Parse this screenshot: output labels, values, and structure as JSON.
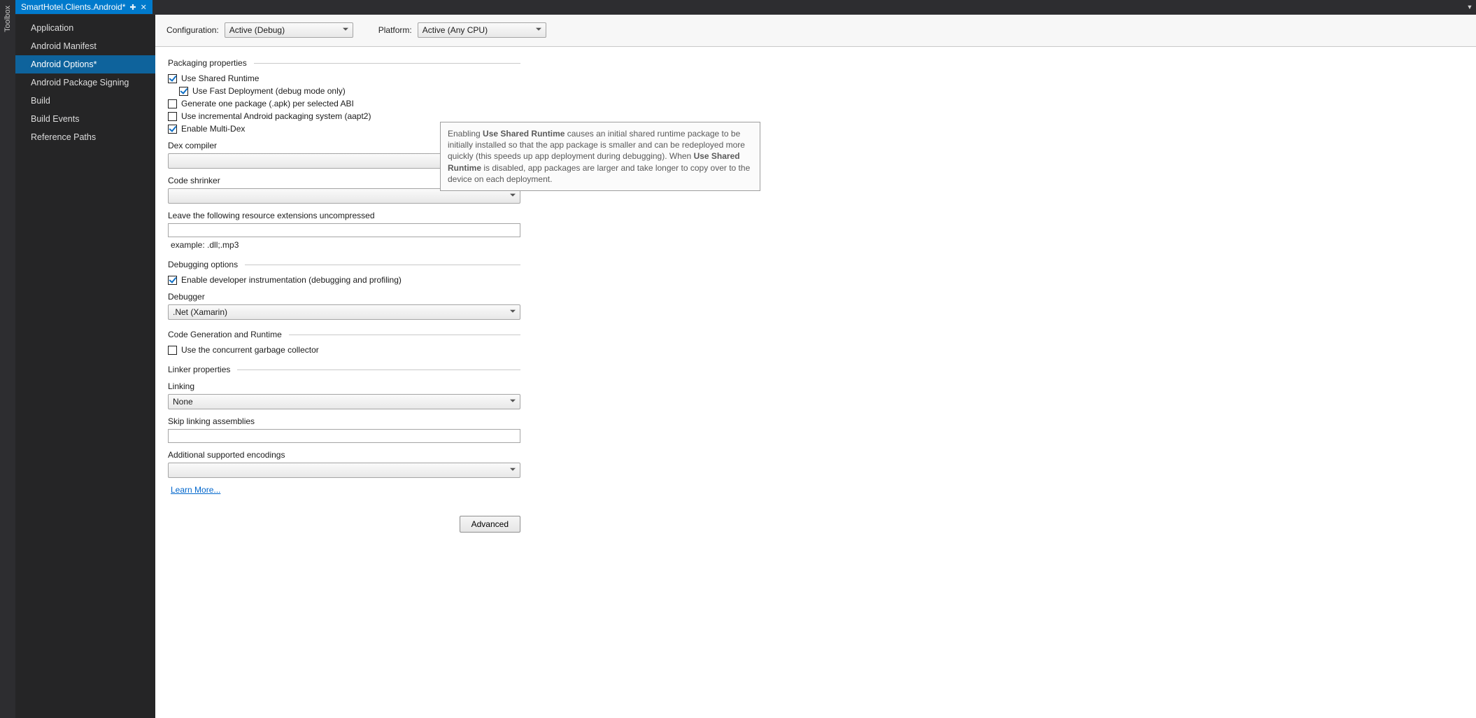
{
  "toolbox": {
    "label": "Toolbox"
  },
  "tab": {
    "title": "SmartHotel.Clients.Android*"
  },
  "sidebar": {
    "items": [
      {
        "label": "Application"
      },
      {
        "label": "Android Manifest"
      },
      {
        "label": "Android Options*"
      },
      {
        "label": "Android Package Signing"
      },
      {
        "label": "Build"
      },
      {
        "label": "Build Events"
      },
      {
        "label": "Reference Paths"
      }
    ],
    "selected_index": 2
  },
  "config": {
    "configuration_label": "Configuration:",
    "configuration_value": "Active (Debug)",
    "platform_label": "Platform:",
    "platform_value": "Active (Any CPU)"
  },
  "sections": {
    "packaging": {
      "title": "Packaging properties",
      "use_shared_runtime": "Use Shared Runtime",
      "use_fast_deployment": "Use Fast Deployment (debug mode only)",
      "generate_one_package": "Generate one package (.apk) per selected ABI",
      "use_incremental": "Use incremental Android packaging system (aapt2)",
      "enable_multidex": "Enable Multi-Dex",
      "dex_compiler_label": "Dex compiler",
      "code_shrinker_label": "Code shrinker",
      "leave_uncompressed_label": "Leave the following resource extensions uncompressed",
      "example_text": "example: .dll;.mp3"
    },
    "debugging": {
      "title": "Debugging options",
      "enable_instrumentation": "Enable developer instrumentation (debugging and profiling)",
      "debugger_label": "Debugger",
      "debugger_value": ".Net (Xamarin)"
    },
    "codegen": {
      "title": "Code Generation and Runtime",
      "concurrent_gc": "Use the concurrent garbage collector"
    },
    "linker": {
      "title": "Linker properties",
      "linking_label": "Linking",
      "linking_value": "None",
      "skip_linking_label": "Skip linking assemblies",
      "additional_encodings_label": "Additional supported encodings",
      "learn_more": "Learn More..."
    },
    "advanced_button": "Advanced"
  },
  "tooltip": {
    "part1": "Enabling ",
    "bold1": "Use Shared Runtime",
    "part2": " causes an initial shared runtime package to be initially installed so that the app package is smaller and can be redeployed more quickly (this speeds up app deployment during debugging). When ",
    "bold2": "Use Shared Runtime",
    "part3": " is disabled, app packages are larger and take longer to copy over to the device on each deployment."
  }
}
